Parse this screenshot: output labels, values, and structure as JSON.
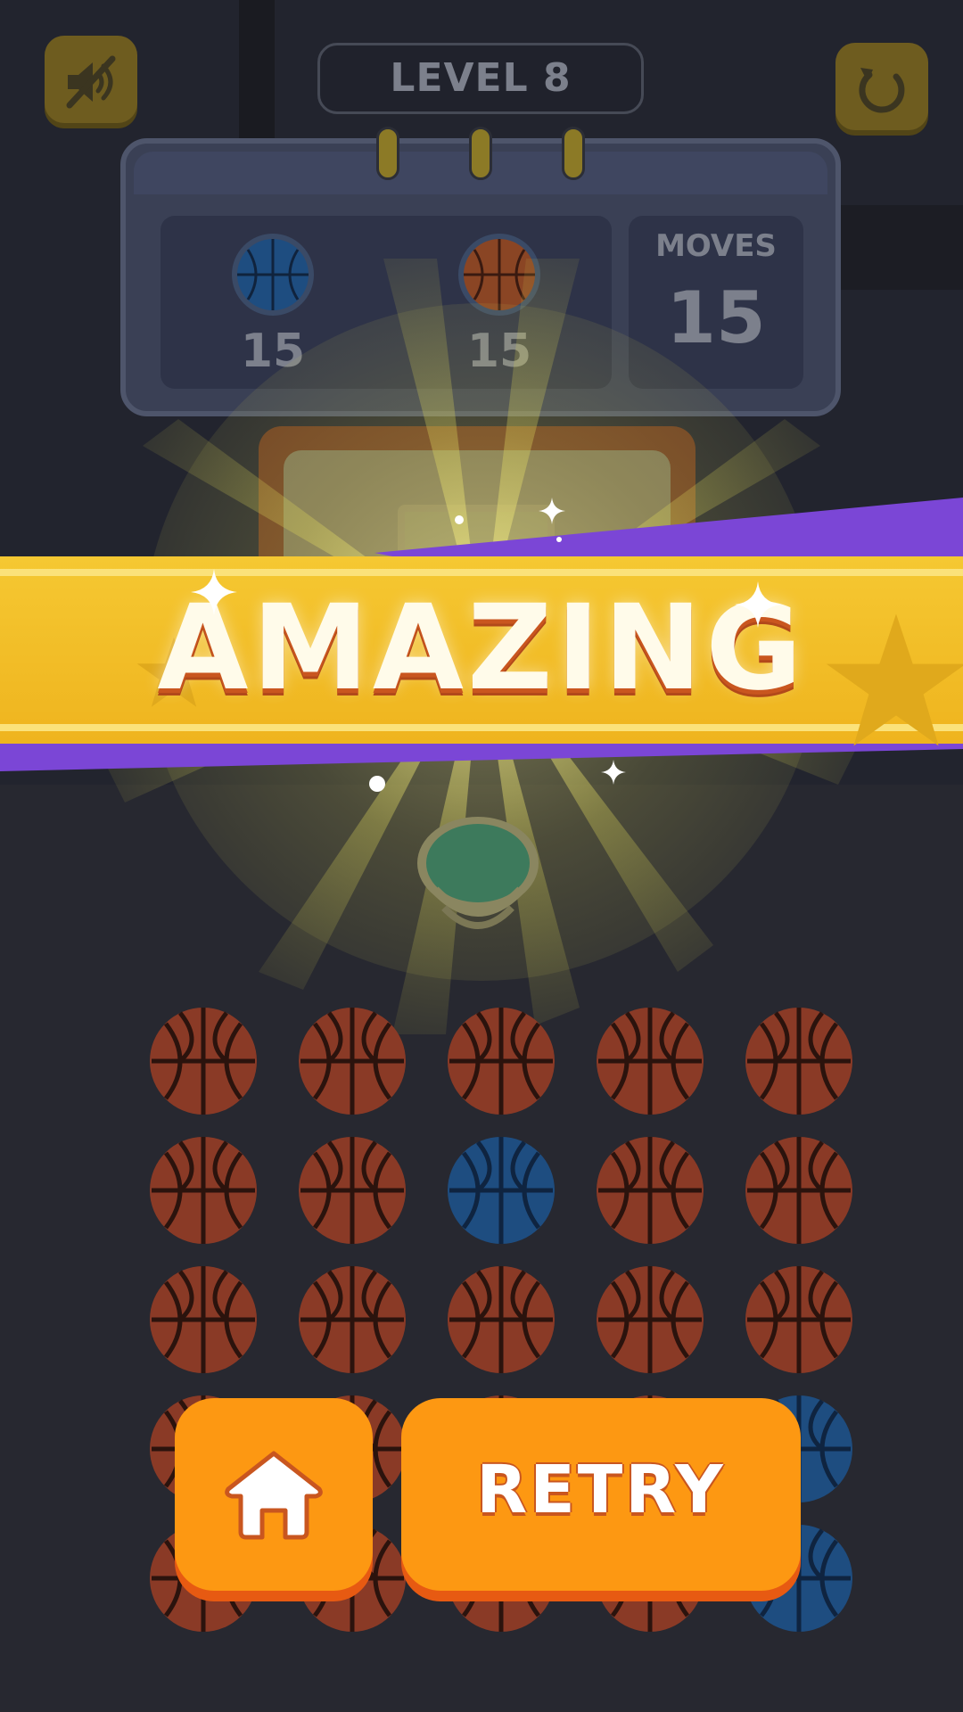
{
  "level": {
    "label": "LEVEL 8"
  },
  "goals": [
    {
      "color": "blue",
      "count": "15",
      "icon": "blue-basketball-icon"
    },
    {
      "color": "orange",
      "count": "15",
      "icon": "orange-basketball-icon"
    }
  ],
  "moves": {
    "label": "MOVES",
    "value": "15"
  },
  "banner": {
    "text": "AMAZING"
  },
  "buttons": {
    "sound": {
      "icon": "sound-muted-icon"
    },
    "restart": {
      "icon": "restart-icon"
    },
    "home": {
      "icon": "home-icon"
    },
    "retry": {
      "label": "RETRY"
    }
  },
  "grid": {
    "rows": [
      [
        "orange",
        "orange",
        "orange",
        "orange",
        "orange"
      ],
      [
        "orange",
        "orange",
        "blue",
        "orange",
        "orange"
      ],
      [
        "orange",
        "orange",
        "orange",
        "orange",
        "orange"
      ],
      [
        "orange",
        "orange",
        "orange",
        "orange",
        "blue"
      ],
      [
        "orange",
        "orange",
        "orange",
        "orange",
        "blue"
      ]
    ]
  },
  "colors": {
    "ball_orange": "#8a3a26",
    "ball_blue": "#1e4d80",
    "banner_yellow": "#f3c22a",
    "banner_purple": "#7b46d6",
    "button_orange": "#fd9812"
  }
}
